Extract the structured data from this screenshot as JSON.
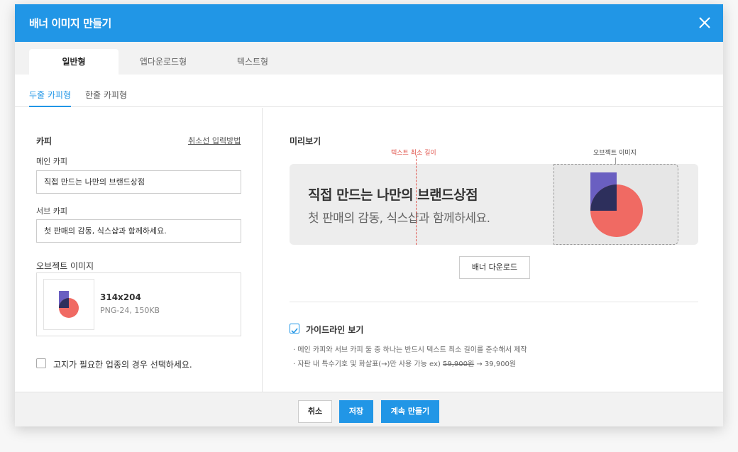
{
  "modal": {
    "title": "배너 이미지 만들기"
  },
  "tabs": [
    {
      "label": "일반형"
    },
    {
      "label": "앱다운로드형"
    },
    {
      "label": "텍스트형"
    }
  ],
  "subtabs": [
    {
      "label": "두줄 카피형"
    },
    {
      "label": "한줄 카피형"
    }
  ],
  "copy": {
    "section_label": "카피",
    "cancel_link": "취소선 입력방법",
    "main_label": "메인 카피",
    "main_value": "직접 만드는 나만의 브랜드상점",
    "sub_label": "서브 카피",
    "sub_value": "첫 판매의 감동, 식스샵과 함께하세요."
  },
  "object_image": {
    "label": "오브젝트 이미지",
    "dimensions": "314x204",
    "format": "PNG-24, 150KB"
  },
  "notice": {
    "label": "고지가 필요한 업종의 경우 선택하세요."
  },
  "preview": {
    "label": "미리보기",
    "min_length_label": "텍스트 최소 길이",
    "object_label": "오브젝트 이미지",
    "main_text": "직접 만드는 나만의 브랜드상점",
    "sub_text": "첫 판매의 감동, 식스샵과 함께하세요.",
    "download_button": "배너 다운로드"
  },
  "guide": {
    "label": "가이드라인 보기",
    "checked": true,
    "line1": "· 메인 카피와 서브 카피 둘 중 하나는 반드시 텍스트 최소 길이를 준수해서 제작",
    "line2_prefix": "· 자판 내 특수기호 및 화살표(→)만 사용 가능 ex)",
    "line2_strike": "59,900원",
    "line2_suffix": "→ 39,900원"
  },
  "footer": {
    "cancel": "취소",
    "save": "저장",
    "continue": "계속 만들기"
  },
  "colors": {
    "accent": "#2196e6",
    "shape_purple": "#6a5fc1",
    "shape_navy": "#2d2f5c",
    "shape_coral": "#f06a63",
    "guide_red": "#e0564e"
  },
  "icons": {
    "close": "close-icon",
    "check": "check-icon"
  }
}
